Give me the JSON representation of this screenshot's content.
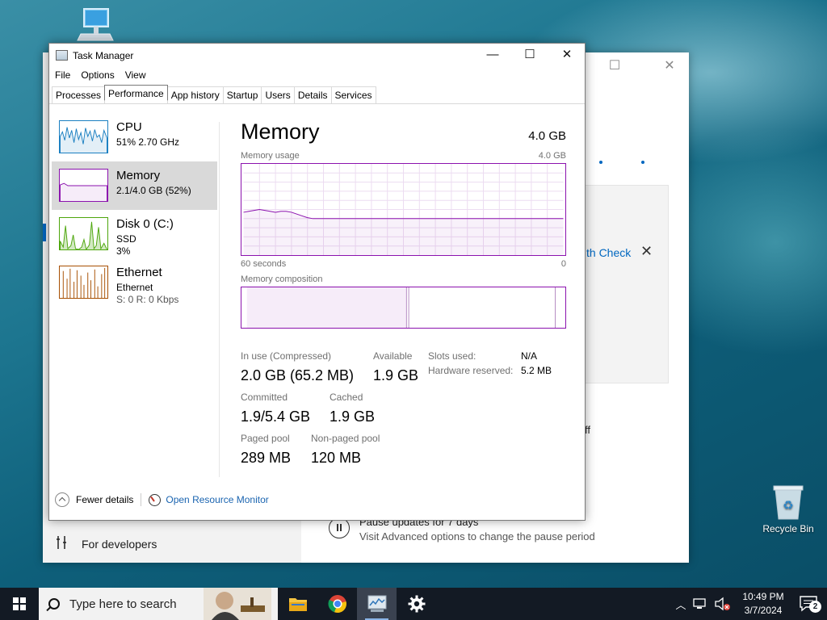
{
  "desktop": {
    "recycle_bin_label": "Recycle Bin"
  },
  "settings_window": {
    "link_fragment": "th Check",
    "toggle_fragment": "ff",
    "for_developers": "For developers",
    "pause_title": "Pause updates for 7 days",
    "pause_subtitle": "Visit Advanced options to change the pause period"
  },
  "task_manager": {
    "title": "Task Manager",
    "menu": [
      "File",
      "Options",
      "View"
    ],
    "tabs": [
      "Processes",
      "Performance",
      "App history",
      "Startup",
      "Users",
      "Details",
      "Services"
    ],
    "active_tab": "Performance",
    "sidebar": [
      {
        "name": "CPU",
        "line1": "51% 2.70 GHz",
        "line2": "",
        "line3": "",
        "color": "#1a7fc1"
      },
      {
        "name": "Memory",
        "line1": "2.1/4.0 GB (52%)",
        "line2": "",
        "line3": "",
        "color": "#8b12ae"
      },
      {
        "name": "Disk 0 (C:)",
        "line1": "SSD",
        "line2": "3%",
        "line3": "",
        "color": "#4da60c"
      },
      {
        "name": "Ethernet",
        "line1": "Ethernet",
        "line2": "S: 0 R: 0 Kbps",
        "line3": "",
        "color": "#a74f01"
      }
    ],
    "memory": {
      "heading": "Memory",
      "total": "4.0 GB",
      "usage_label": "Memory usage",
      "usage_max": "4.0 GB",
      "x_left": "60 seconds",
      "x_right": "0",
      "composition_label": "Memory composition",
      "in_use_label": "In use (Compressed)",
      "in_use_value": "2.0 GB (65.2 MB)",
      "available_label": "Available",
      "available_value": "1.9 GB",
      "committed_label": "Committed",
      "committed_value": "1.9/5.4 GB",
      "cached_label": "Cached",
      "cached_value": "1.9 GB",
      "paged_label": "Paged pool",
      "paged_value": "289 MB",
      "nonpaged_label": "Non-paged pool",
      "nonpaged_value": "120 MB",
      "slots_label": "Slots used:",
      "slots_value": "N/A",
      "hw_label": "Hardware reserved:",
      "hw_value": "5.2 MB",
      "usage_series_pct": [
        47,
        48,
        49,
        50,
        49,
        48,
        47,
        48,
        48,
        47,
        45,
        43,
        41,
        40,
        40,
        40,
        40,
        40,
        40,
        40,
        40,
        40,
        40,
        40,
        40,
        40,
        40,
        40,
        40,
        40,
        40,
        40,
        40,
        40,
        40,
        40,
        40,
        40,
        40,
        40,
        40,
        40,
        40,
        40,
        40,
        40,
        40,
        40,
        40,
        40,
        40,
        40,
        40,
        40,
        40,
        40,
        40,
        40,
        40,
        40,
        40
      ],
      "composition_in_use_fraction": 0.51,
      "composition_standby_end_fraction": 0.985
    },
    "footer": {
      "fewer_details": "Fewer details",
      "open_resource_monitor": "Open Resource Monitor"
    }
  },
  "taskbar": {
    "search_placeholder": "Type here to search",
    "time": "10:49 PM",
    "date": "3/7/2024",
    "notification_count": "2"
  }
}
